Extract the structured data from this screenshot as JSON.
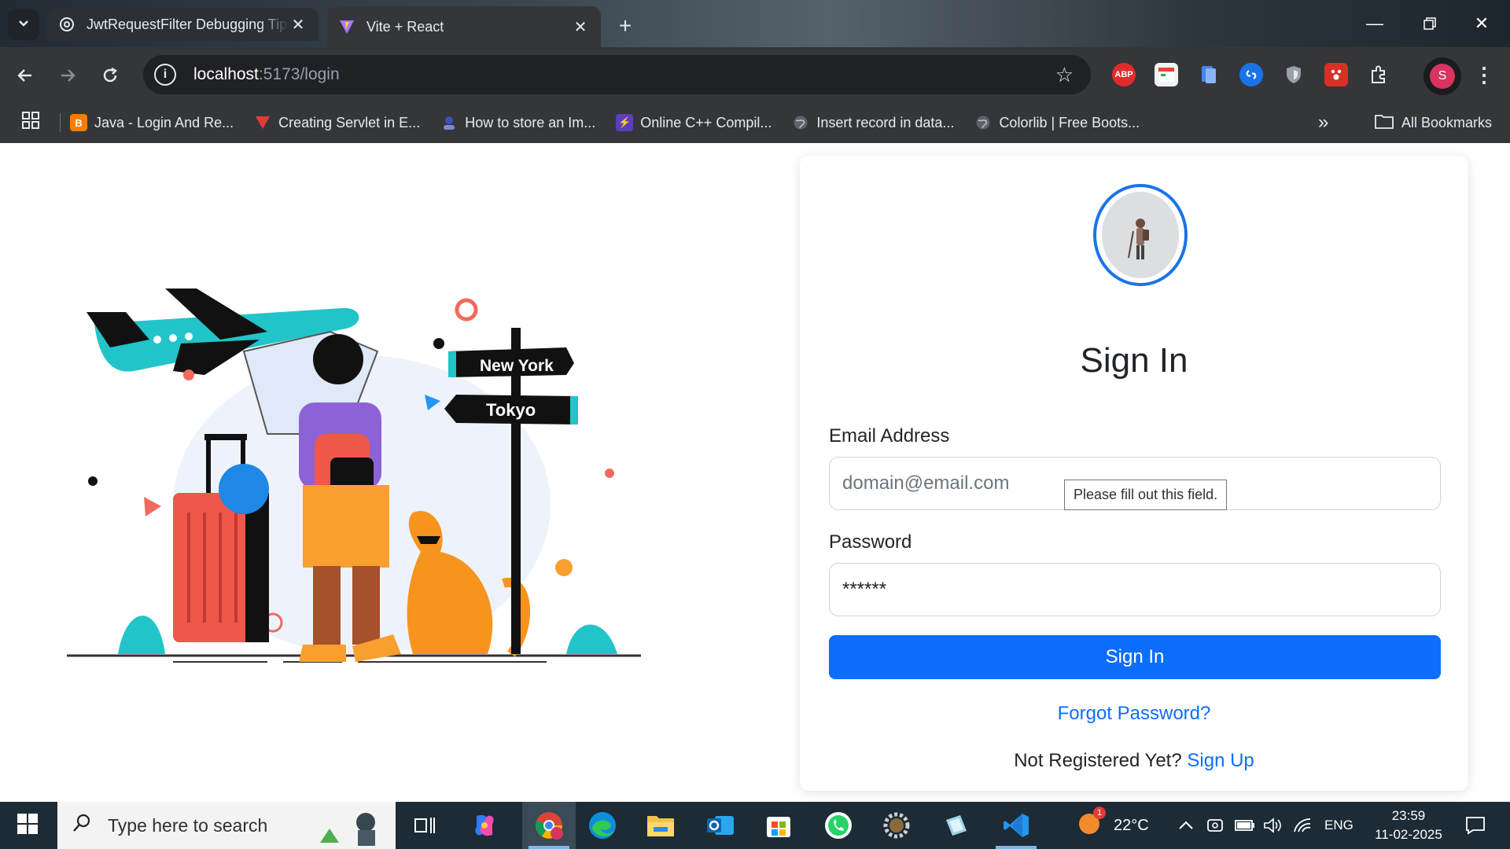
{
  "browser": {
    "tabs": [
      {
        "title": "JwtRequestFilter Debugging Tips",
        "active": false
      },
      {
        "title": "Vite + React",
        "active": true
      }
    ],
    "url_host": "localhost",
    "url_path": ":5173/login",
    "profile_initial": "S",
    "bookmarks": [
      {
        "label": "Java - Login And Re...",
        "icon": "blogger-icon",
        "color": "#f57d00"
      },
      {
        "label": "Creating Servlet in E...",
        "icon": "triangle-icon",
        "color": "#e53935"
      },
      {
        "label": "How to store an Im...",
        "icon": "avatar-icon",
        "color": "#3f51b5"
      },
      {
        "label": "Online C++ Compil...",
        "icon": "bolt-icon",
        "color": "#5b3fbf"
      },
      {
        "label": "Insert record in data...",
        "icon": "globe-icon",
        "color": "#5f6368"
      },
      {
        "label": "Colorlib | Free Boots...",
        "icon": "globe-icon",
        "color": "#5f6368"
      }
    ],
    "all_bookmarks_label": "All Bookmarks",
    "extensions": [
      {
        "label": "ABP",
        "color": "#e22b2b"
      },
      {
        "label": "",
        "color": "#f1f3f4"
      },
      {
        "label": "",
        "color": "#4285f4"
      },
      {
        "label": "",
        "color": "#1a73e8"
      },
      {
        "label": "",
        "color": "#9aa0a6"
      },
      {
        "label": "",
        "color": "#d93025"
      }
    ]
  },
  "page": {
    "illustration": {
      "sign_top": "New York",
      "sign_bottom": "Tokyo"
    },
    "card": {
      "title": "Sign In",
      "email_label": "Email Address",
      "email_placeholder": "domain@email.com",
      "password_label": "Password",
      "password_value": "******",
      "validation_tooltip": "Please fill out this field.",
      "submit_label": "Sign In",
      "forgot_link": "Forgot Password?",
      "register_prompt": "Not Registered Yet?",
      "register_link": "Sign Up"
    },
    "colors": {
      "primary": "#0d6efd"
    }
  },
  "taskbar": {
    "search_placeholder": "Type here to search",
    "weather_temp": "22°C",
    "weather_badge": "1",
    "language": "ENG",
    "time": "23:59",
    "date": "11-02-2025"
  }
}
